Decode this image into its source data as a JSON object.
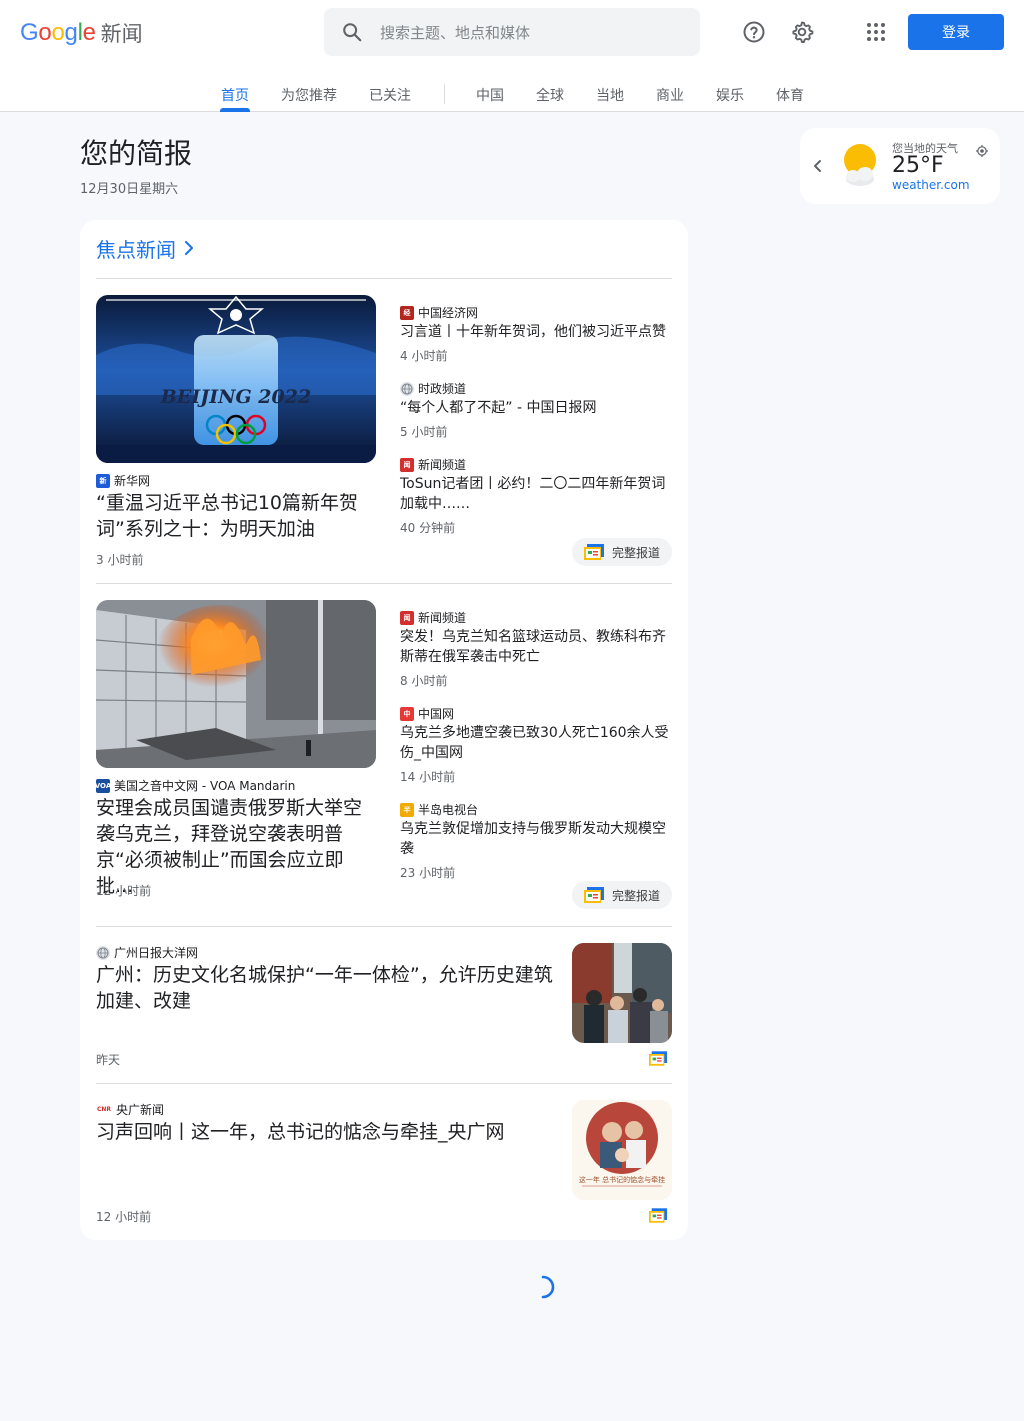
{
  "header": {
    "logo_word": "Google",
    "logo_suffix": "新闻",
    "search_placeholder": "搜索主题、地点和媒体",
    "login_label": "登录"
  },
  "nav": {
    "tabs": [
      "首页",
      "为您推荐",
      "已关注",
      "中国",
      "全球",
      "当地",
      "商业",
      "娱乐",
      "体育"
    ],
    "active_tab": "首页"
  },
  "briefing": {
    "title": "您的简报",
    "date": "12月30日星期六"
  },
  "weather": {
    "label": "您当地的天气",
    "temp": "25°F",
    "source": "weather.com"
  },
  "top_stories": {
    "heading": "焦点新闻",
    "full_coverage_label": "完整报道",
    "clusters": [
      {
        "main": {
          "source": "新华网",
          "title": "“重温习近平总书记10篇新年贺词”系列之十：为明天加油",
          "time": "3 小时前"
        },
        "side": [
          {
            "source": "中国经济网",
            "title": "习言道丨十年新年贺词，他们被习近平点赞",
            "time": "4 小时前"
          },
          {
            "source": "时政频道",
            "title": "“每个人都了不起” - 中国日报网",
            "time": "5 小时前"
          },
          {
            "source": "新闻频道",
            "title": "ToSun记者团丨必约！二〇二四年新年贺词加载中……",
            "time": "40 分钟前"
          }
        ]
      },
      {
        "main": {
          "source": "美国之音中文网 - VOA Mandarin",
          "title": "安理会成员国谴责俄罗斯大举空袭乌克兰，拜登说空袭表明普京“必须被制止”而国会应立即批...",
          "time": "12 小时前"
        },
        "side": [
          {
            "source": "新闻频道",
            "title": "突发！乌克兰知名篮球运动员、教练科布齐斯蒂在俄军袭击中死亡",
            "time": "8 小时前"
          },
          {
            "source": "中国网",
            "title": "乌克兰多地遭空袭已致30人死亡160余人受伤_中国网",
            "time": "14 小时前"
          },
          {
            "source": "半岛电视台",
            "title": "乌克兰敦促增加支持与俄罗斯发动大规模空袭",
            "time": "23 小时前"
          }
        ]
      }
    ],
    "singles": [
      {
        "source": "广州日报大洋网",
        "title": "广州：历史文化名城保护“一年一体检”，允许历史建筑加建、改建",
        "time": "昨天"
      },
      {
        "source": "央广新闻",
        "source_badge": "CNR",
        "title": "习声回响丨这一年，总书记的惦念与牵挂_央广网",
        "time": "12 小时前",
        "image_caption": "这一年 总书记的惦念与牵挂"
      }
    ]
  },
  "colors": {
    "accent": "#1a73e8",
    "background": "#f6f8fc",
    "card": "#ffffff"
  }
}
